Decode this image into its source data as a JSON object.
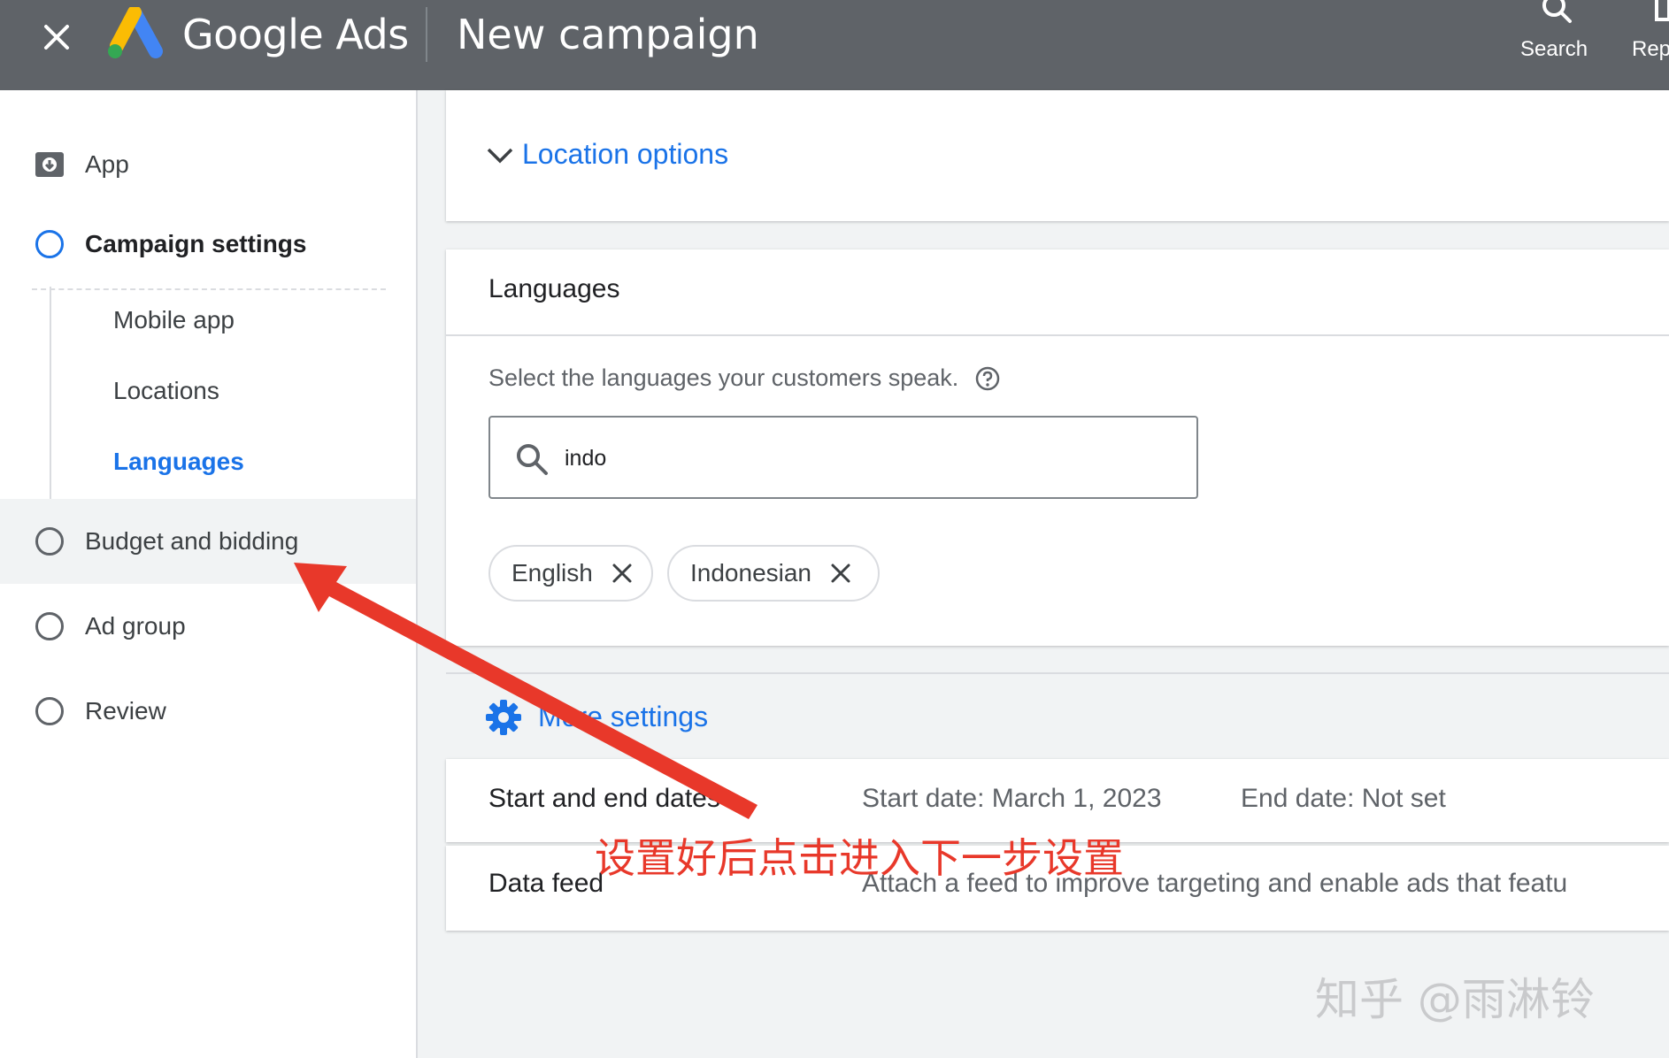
{
  "header": {
    "brand": "Google Ads",
    "title": "New campaign",
    "actions": [
      {
        "icon": "search-icon",
        "label": "Search"
      },
      {
        "icon": "reports-icon",
        "label": "Rep"
      }
    ]
  },
  "sidebar": {
    "app": {
      "icon": "app-download-icon",
      "label": "App"
    },
    "campaign_settings": "Campaign settings",
    "sub_items": [
      "Mobile app",
      "Locations",
      "Languages"
    ],
    "items": [
      "Budget and bidding",
      "Ad group",
      "Review"
    ]
  },
  "main": {
    "location_options": "Location options",
    "languages": {
      "title": "Languages",
      "prompt": "Select the languages your customers speak.",
      "search_value": "indo",
      "chips": [
        "English",
        "Indonesian"
      ]
    },
    "more_settings": "More settings",
    "rows": [
      {
        "label": "Start and end dates",
        "value": "Start date: March 1, 2023",
        "value2": "End date: Not set"
      },
      {
        "label": "Data feed",
        "value": "Attach a feed to improve targeting and enable ads that featu"
      }
    ]
  },
  "annotation": "设置好后点击进入下一步设置",
  "watermark": "知乎 @雨淋铃",
  "colors": {
    "header": "#5f6368",
    "accent": "#1a73e8",
    "annotation": "#e8382a"
  }
}
